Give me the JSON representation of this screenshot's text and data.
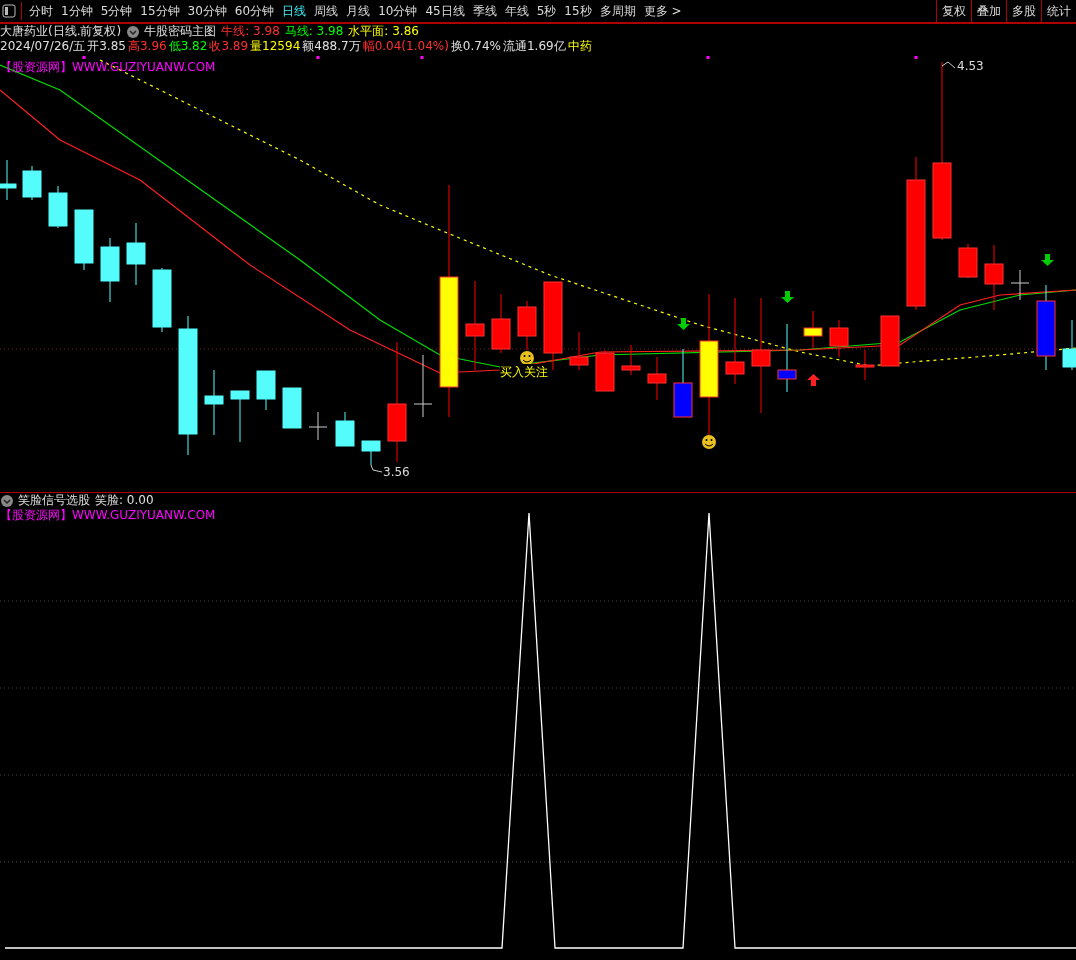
{
  "toolbar": {
    "tabs": [
      {
        "label": "分时",
        "selected": false
      },
      {
        "label": "1分钟",
        "selected": false
      },
      {
        "label": "5分钟",
        "selected": false
      },
      {
        "label": "15分钟",
        "selected": false
      },
      {
        "label": "30分钟",
        "selected": false
      },
      {
        "label": "60分钟",
        "selected": false
      },
      {
        "label": "日线",
        "selected": true
      },
      {
        "label": "周线",
        "selected": false
      },
      {
        "label": "月线",
        "selected": false
      },
      {
        "label": "10分钟",
        "selected": false
      },
      {
        "label": "45日线",
        "selected": false
      },
      {
        "label": "季线",
        "selected": false
      },
      {
        "label": "年线",
        "selected": false
      },
      {
        "label": "5秒",
        "selected": false
      },
      {
        "label": "15秒",
        "selected": false
      },
      {
        "label": "多周期",
        "selected": false
      },
      {
        "label": "更多 >",
        "selected": false
      }
    ],
    "buttons": [
      "复权",
      "叠加",
      "多股",
      "统计"
    ]
  },
  "main_chart": {
    "stock_title": "大唐药业(日线.前复权)",
    "indicator": "牛股密码主图",
    "indicator_values": [
      {
        "text": "牛线: 3.98",
        "color": "#ff3030"
      },
      {
        "text": "马线: 3.98",
        "color": "#00ff00"
      },
      {
        "text": "水平面: 3.86",
        "color": "#ffff00"
      }
    ],
    "quote": [
      {
        "text": "2024/07/26/五",
        "color": "#e0e0e0"
      },
      {
        "text": "开3.85",
        "color": "#e0e0e0"
      },
      {
        "text": "高3.96",
        "color": "#ff3030"
      },
      {
        "text": "低3.82",
        "color": "#00ff00"
      },
      {
        "text": "收3.89",
        "color": "#ff3030"
      },
      {
        "text": "量12594",
        "color": "#ffff00"
      },
      {
        "text": "额488.7万",
        "color": "#e0e0e0"
      },
      {
        "text": "幅0.04(1.04%)",
        "color": "#ff3030"
      },
      {
        "text": "换0.74%",
        "color": "#e0e0e0"
      },
      {
        "text": "流通1.69亿",
        "color": "#e0e0e0"
      },
      {
        "text": "中药",
        "color": "#ffff00"
      }
    ],
    "site_label": "【股资源网】WWW.GUZIYUANW.COM",
    "high_label": "4.53",
    "low_label": "3.56",
    "signal_label": "买入关注"
  },
  "sub_chart": {
    "indicator": "笑脸信号选股",
    "value": "笑脸: 0.00",
    "site_label": "【股资源网】WWW.GUZIYUANW.COM"
  }
}
